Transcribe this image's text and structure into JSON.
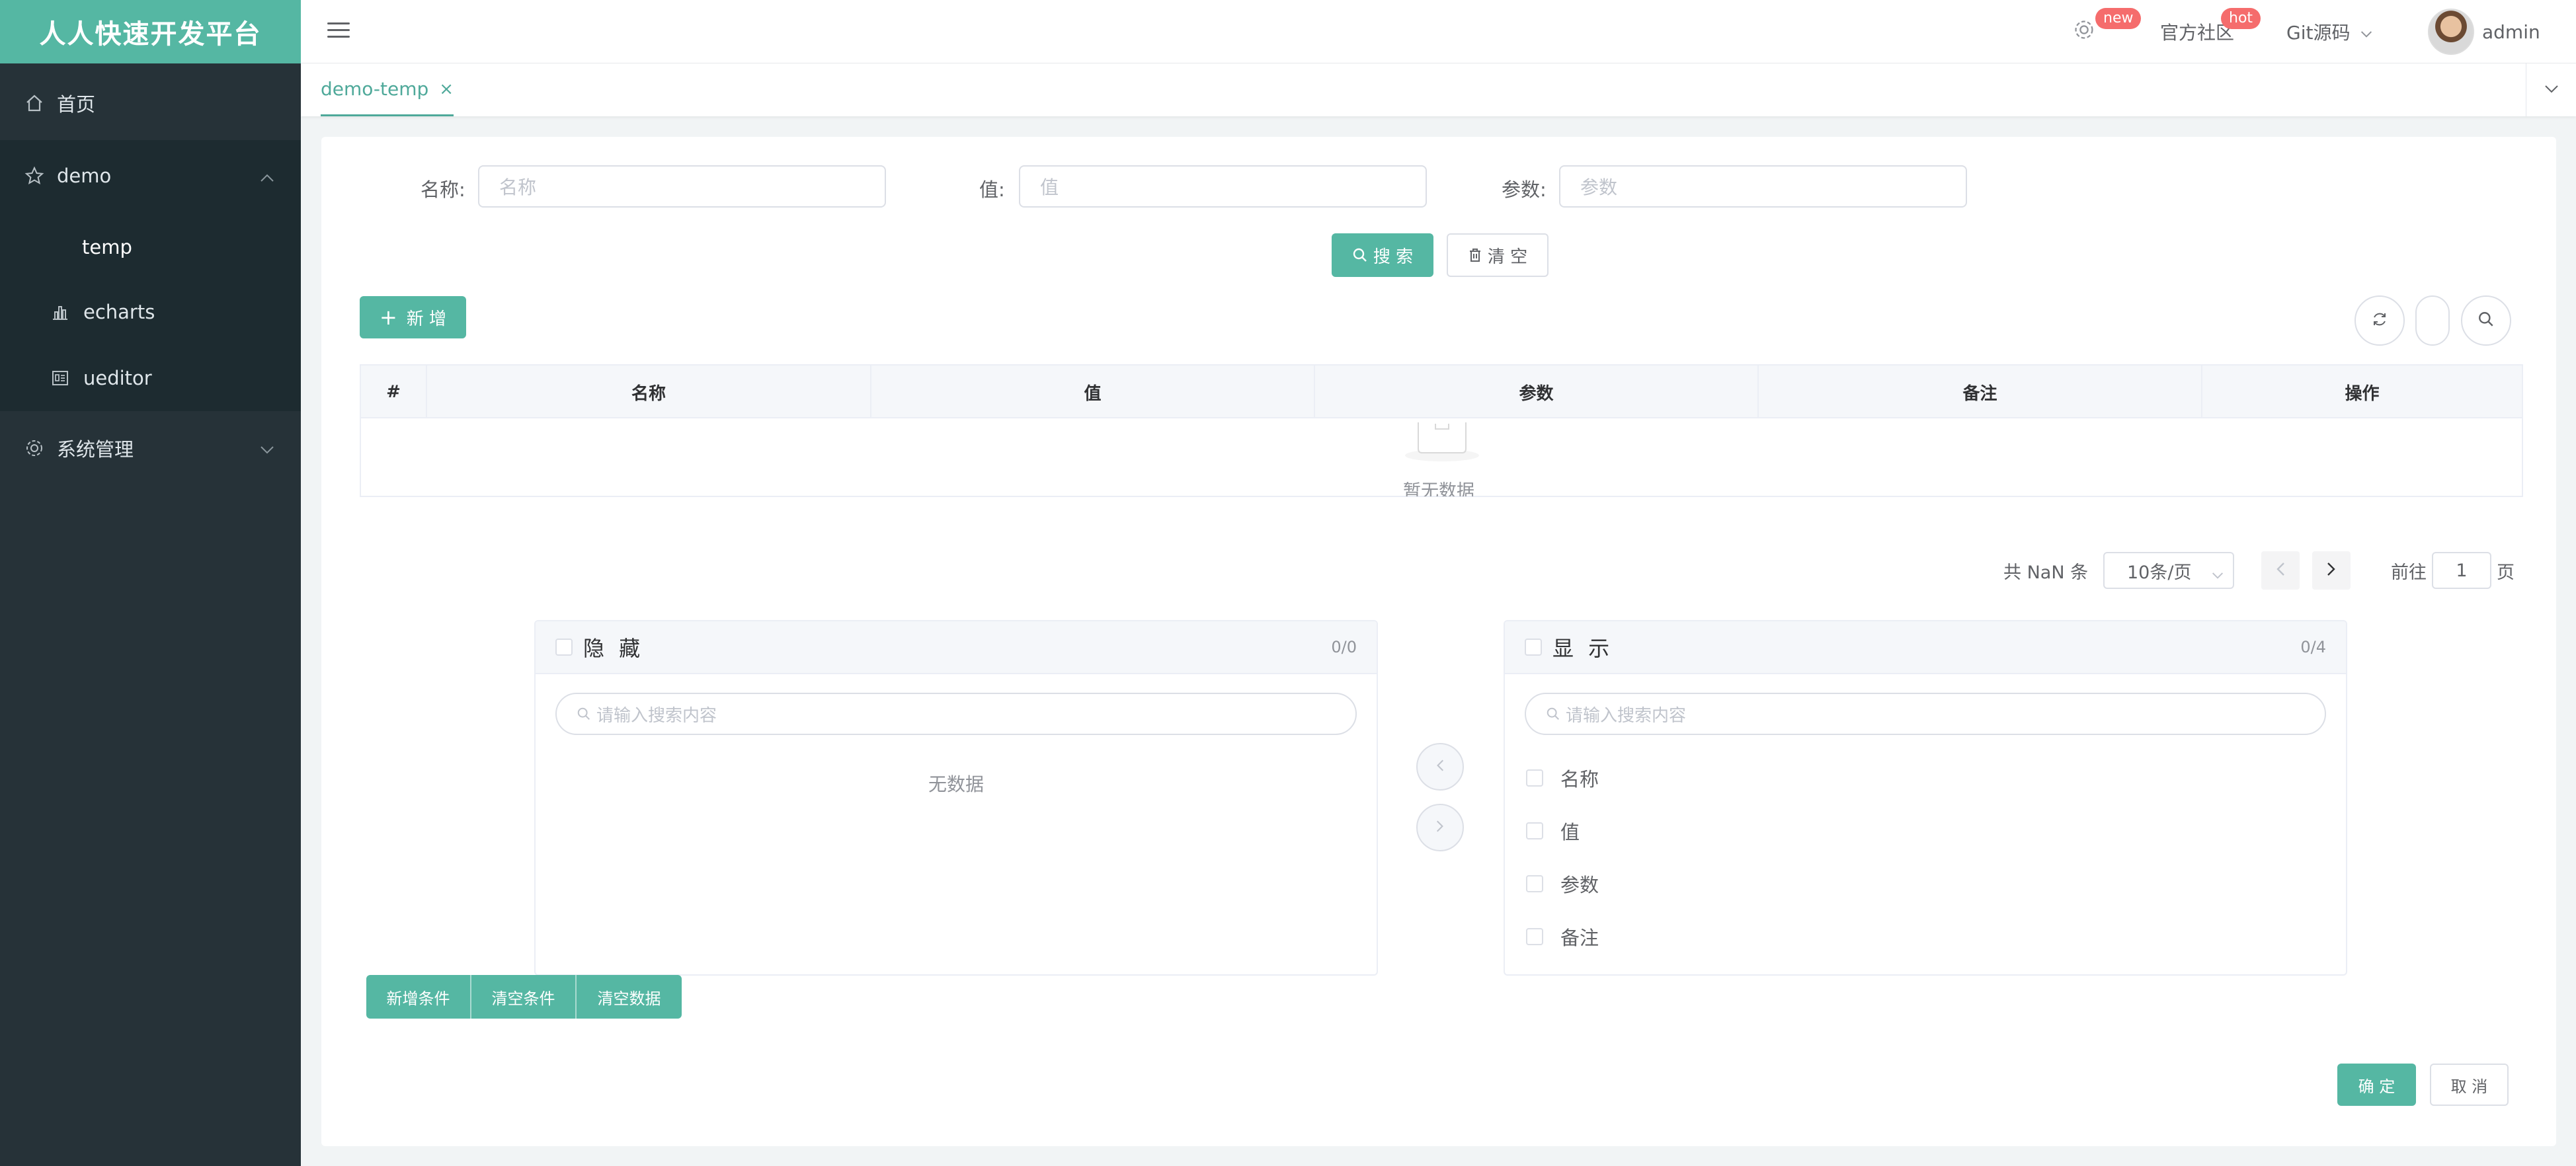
{
  "app": {
    "title": "人人快速开发平台",
    "accent": "#55b7a3"
  },
  "sidebar": {
    "items": [
      {
        "label": "首页",
        "icon": "home-icon"
      },
      {
        "label": "demo",
        "icon": "star-icon",
        "expanded": true,
        "children": [
          {
            "label": "temp",
            "active": true
          },
          {
            "label": "echarts",
            "icon": "bar-chart-icon"
          },
          {
            "label": "ueditor",
            "icon": "editor-icon"
          }
        ]
      },
      {
        "label": "系统管理",
        "icon": "gear-icon",
        "expanded": false
      }
    ]
  },
  "header": {
    "new_badge": "new",
    "hot_badge": "hot",
    "community": "官方社区",
    "git": "Git源码",
    "user": "admin"
  },
  "tabs": [
    {
      "label": "demo-temp",
      "active": true
    }
  ],
  "search": {
    "fields": [
      {
        "label": "名称:",
        "placeholder": "名称"
      },
      {
        "label": "值:",
        "placeholder": "值"
      },
      {
        "label": "参数:",
        "placeholder": "参数"
      }
    ],
    "search_btn": "搜 索",
    "clear_btn": "清 空"
  },
  "toolbar": {
    "add_btn": "新 增"
  },
  "table": {
    "columns": [
      "#",
      "名称",
      "值",
      "参数",
      "备注",
      "操作"
    ],
    "empty_text": "暂无数据"
  },
  "pagination": {
    "total": "共 NaN 条",
    "page_size": "10条/页",
    "goto_label": "前往",
    "page": "1",
    "page_suffix": "页"
  },
  "transfer": {
    "left": {
      "title": "隐 藏",
      "count": "0/0",
      "placeholder": "请输入搜索内容",
      "empty": "无数据"
    },
    "right": {
      "title": "显 示",
      "count": "0/4",
      "placeholder": "请输入搜索内容",
      "items": [
        "名称",
        "值",
        "参数",
        "备注"
      ]
    }
  },
  "actions": {
    "add_condition": "新增条件",
    "clear_condition": "清空条件",
    "clear_data": "清空数据",
    "confirm": "确 定",
    "cancel": "取 消"
  }
}
